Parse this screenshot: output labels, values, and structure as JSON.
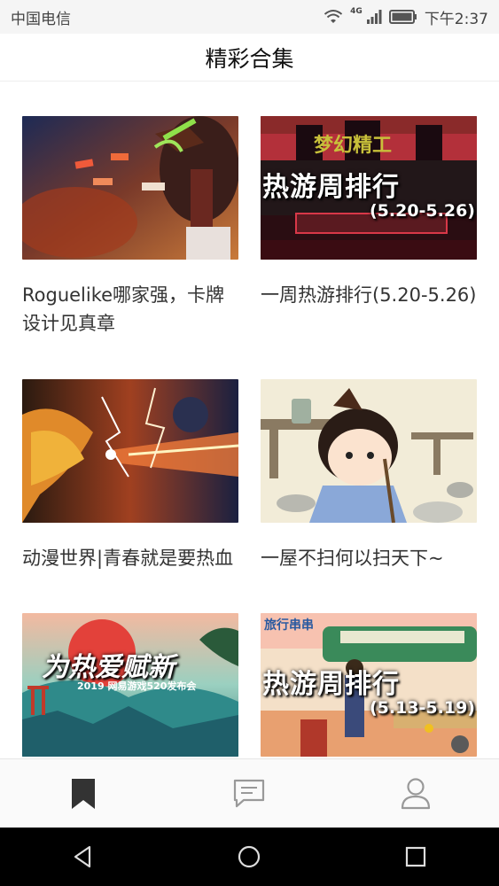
{
  "status_bar": {
    "carrier": "中国电信",
    "network": "4G",
    "time": "下午2:37",
    "icons": [
      "wifi-icon",
      "signal-icon",
      "battery-icon"
    ]
  },
  "header": {
    "title": "精彩合集"
  },
  "cards": [
    {
      "caption": "Roguelike哪家强，卡牌设计见真章"
    },
    {
      "caption": "一周热游排行(5.20-5.26)",
      "overlay_title": "热游周排行",
      "overlay_date": "(5.20-5.26)",
      "overlay_top": "梦幻精工"
    },
    {
      "caption": "动漫世界|青春就是要热血"
    },
    {
      "caption": "一屋不扫何以扫天下~"
    },
    {
      "caption": "",
      "overlay_title": "为热爱赋新",
      "overlay_sub": "2019 网易游戏520发布会"
    },
    {
      "caption": "",
      "overlay_title": "热游周排行",
      "overlay_date": "(5.13-5.19)",
      "overlay_top": "旅行串串"
    }
  ],
  "bottom_nav": [
    {
      "icon": "bookmark-icon",
      "active": true
    },
    {
      "icon": "message-icon",
      "active": false
    },
    {
      "icon": "profile-icon",
      "active": false
    }
  ],
  "system_nav": [
    "back-icon",
    "home-icon",
    "recents-icon"
  ],
  "colors": {
    "active": "#333333",
    "inactive": "#999999",
    "sys_bg": "#000000"
  }
}
